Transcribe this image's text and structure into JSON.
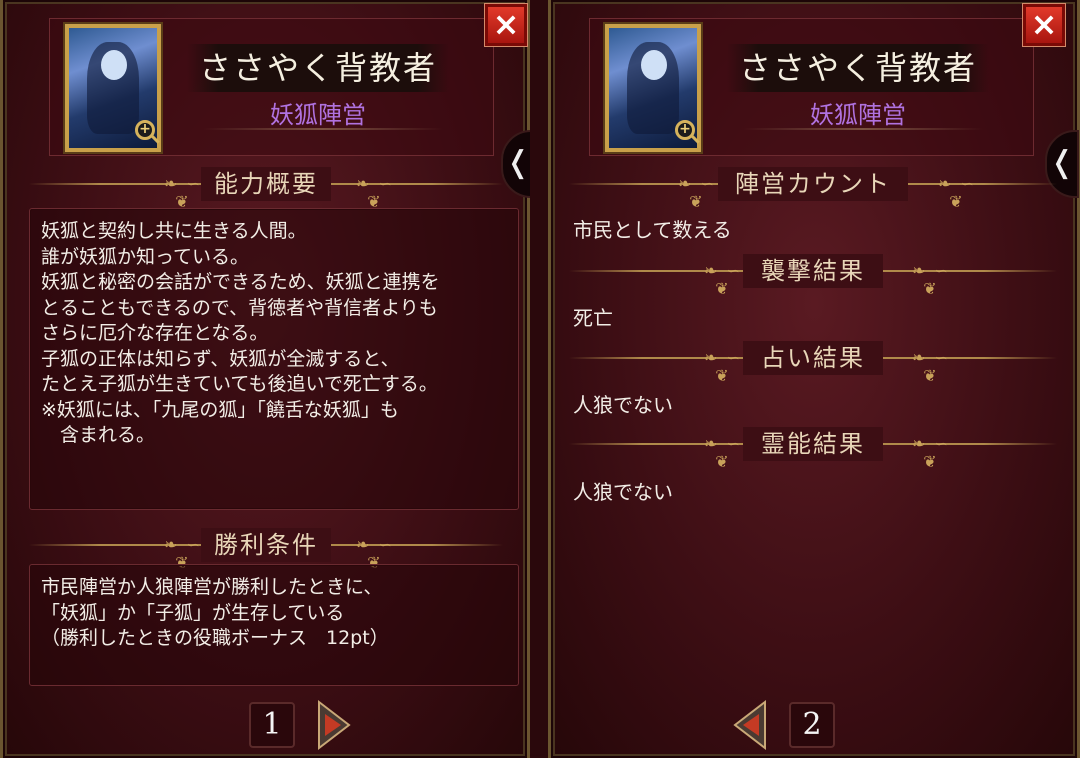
{
  "colors": {
    "panel_bg": "#3d0e14",
    "gold": "#c9a04a",
    "faction_purple": "#b072e0",
    "close_red": "#d42a1e",
    "text": "#f2ede6"
  },
  "left_panel": {
    "role_name": "ささやく背教者",
    "faction": "妖狐陣営",
    "close_icon": "×",
    "side_tab_icon": "chevron-left-icon",
    "side_tab_glyph": "❬",
    "ability_title": "能力概要",
    "ability_lines": [
      "妖狐と契約し共に生きる人間。",
      "誰が妖狐か知っている。",
      "妖狐と秘密の会話ができるため、妖狐と連携を",
      "とることもできるので、背徳者や背信者よりも",
      "さらに厄介な存在となる。",
      "子狐の正体は知らず、妖狐が全滅すると、",
      "たとえ子狐が生きていても後追いで死亡する。",
      "※妖狐には、「九尾の狐」「饒舌な妖狐」も",
      "　含まれる。"
    ],
    "victory_title": "勝利条件",
    "victory_lines": [
      "市民陣営か人狼陣営が勝利したときに、",
      "「妖狐」か「子狐」が生存している",
      "（勝利したときの役職ボーナス　12pt）"
    ],
    "page_number": "1"
  },
  "right_panel": {
    "role_name": "ささやく背教者",
    "faction": "妖狐陣営",
    "close_icon": "×",
    "side_tab_glyph": "❬",
    "sections": [
      {
        "title": "陣営カウント",
        "value": "市民として数える"
      },
      {
        "title": "襲撃結果",
        "value": "死亡"
      },
      {
        "title": "占い結果",
        "value": "人狼でない"
      },
      {
        "title": "霊能結果",
        "value": "人狼でない"
      }
    ],
    "page_number": "2"
  }
}
